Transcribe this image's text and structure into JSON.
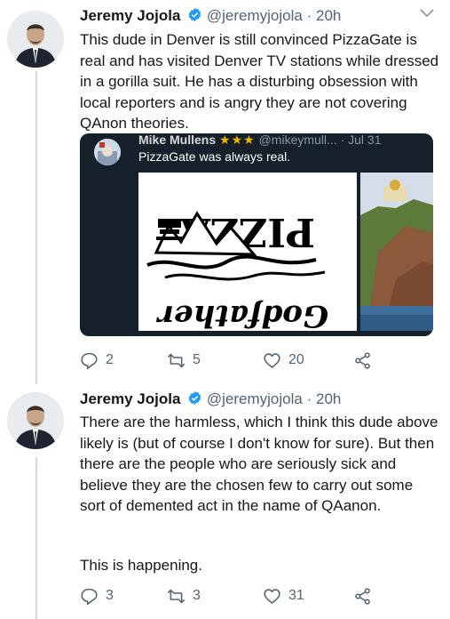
{
  "tweets": [
    {
      "name": "Jeremy Jojola",
      "handle": "@jeremyjojola",
      "separator": "·",
      "time": "20h",
      "text": "This dude in Denver is still convinced PizzaGate is real and has visited Denver TV stations while dressed in a gorilla suit. He has a disturbing obsession with local reporters and is angry they are not covering QAnon theories.",
      "quote": {
        "name": "Mike Mullens",
        "stars": "★★★",
        "handle": "@mikeymull...",
        "separator": "·",
        "date": "Jul 31",
        "text": "PizzaGate was always real.",
        "image_left_top": "PIZZA",
        "image_left_bottom": "Godfather"
      },
      "actions": {
        "replies": "2",
        "retweets": "5",
        "likes": "20"
      }
    },
    {
      "name": "Jeremy Jojola",
      "handle": "@jeremyjojola",
      "separator": "·",
      "time": "20h",
      "text": "There are the harmless, which I think this dude above likely is (but of course I don't know for sure). But then there are the people who are seriously sick and believe they are the chosen few to carry out some sort of demented act in the name of QAanon.",
      "text2": "This is happening.",
      "actions": {
        "replies": "3",
        "retweets": "3",
        "likes": "31"
      }
    }
  ],
  "colors": {
    "verified": "#1d9bf0",
    "muted": "#536471",
    "quote_bg": "#15202b"
  },
  "icons": [
    "verified-badge-icon",
    "chevron-down-icon",
    "reply-icon",
    "retweet-icon",
    "like-icon",
    "share-icon"
  ]
}
